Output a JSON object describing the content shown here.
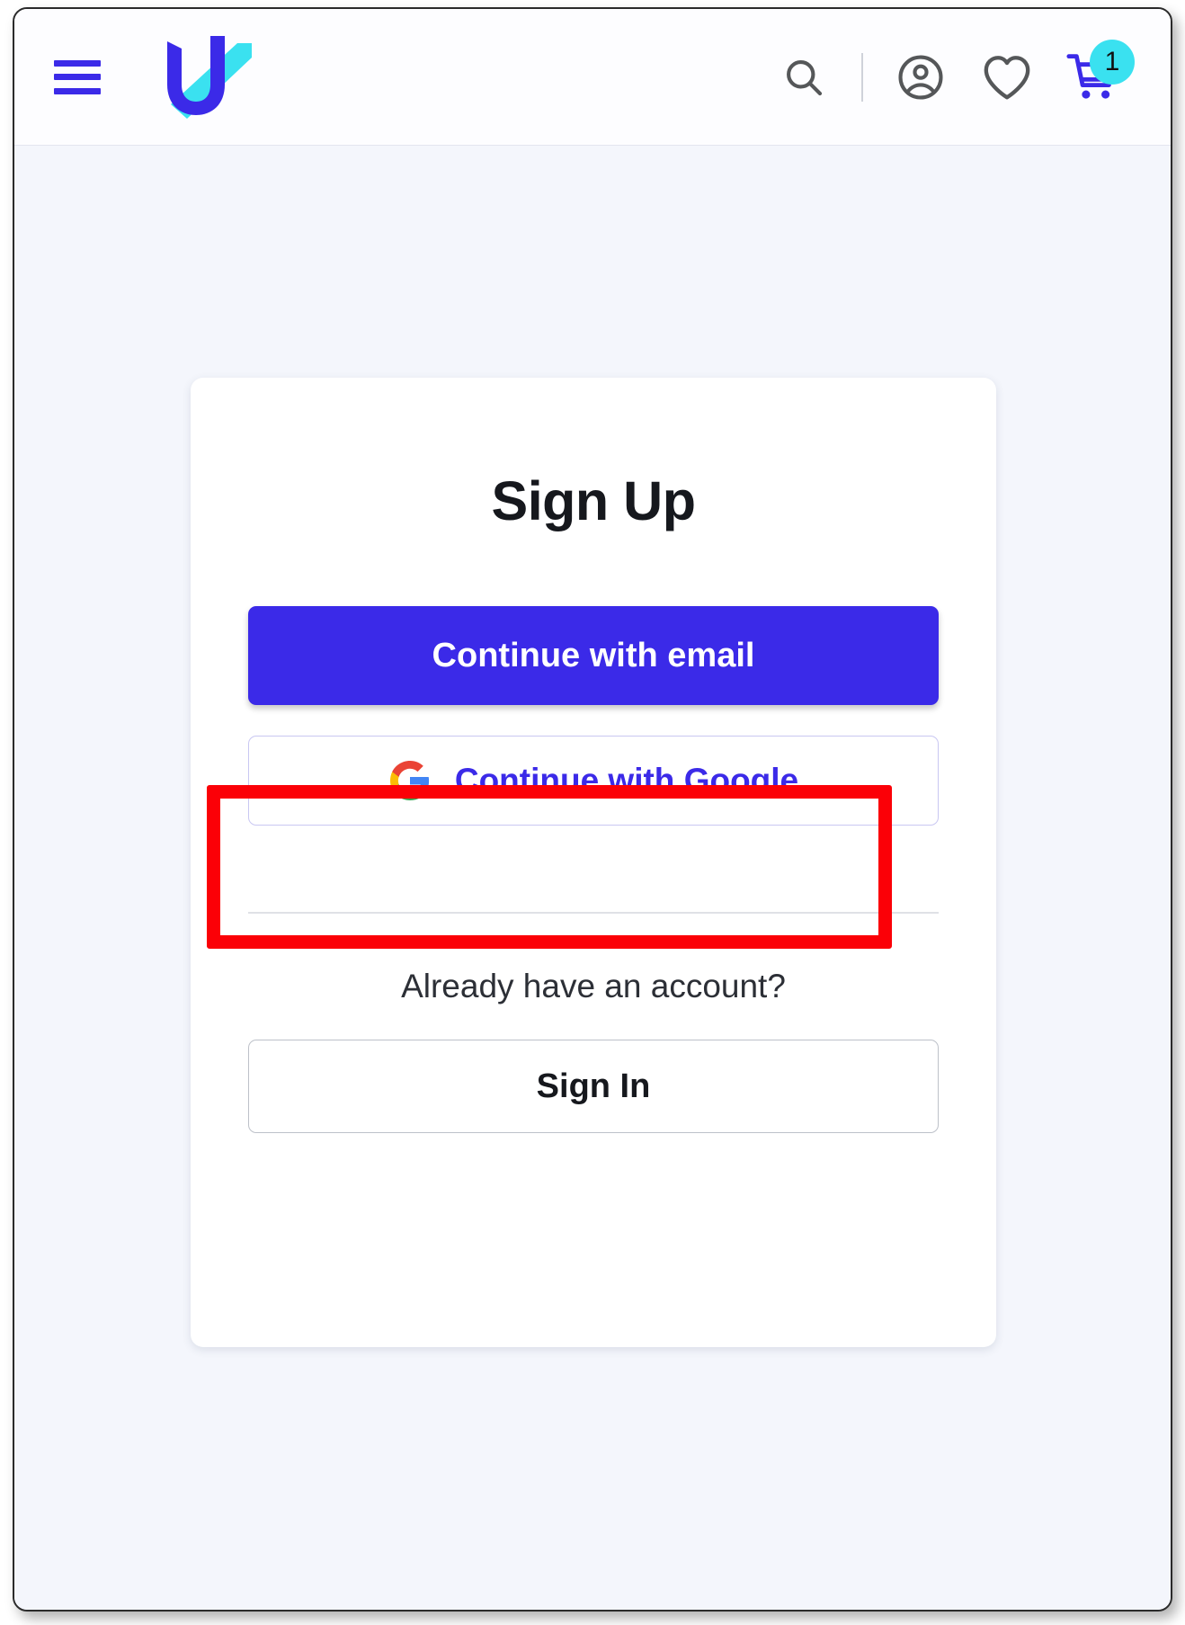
{
  "header": {
    "menu_icon": "hamburger-menu-icon",
    "logo_alt": "U",
    "brand_color": "#3b2ae8",
    "brand_accent_color": "#3ae1f0",
    "actions": [
      {
        "name": "search",
        "icon": "search-icon"
      },
      {
        "name": "account",
        "icon": "user-circle-icon"
      },
      {
        "name": "wishlist",
        "icon": "heart-icon"
      },
      {
        "name": "cart",
        "icon": "shopping-cart-icon"
      }
    ],
    "cart_badge_count": "1"
  },
  "card": {
    "title": "Sign Up",
    "email_button_label": "Continue with email",
    "google_button_label": "Continue with Google",
    "google_icon": "google-g-icon",
    "already_have_account": "Already have an account?",
    "sign_in_button_label": "Sign In"
  },
  "annotation": {
    "type": "highlight-rectangle",
    "color": "#fb0007",
    "target": "Continue with email"
  },
  "colors": {
    "primary": "#3b2ae8",
    "accent_cyan": "#3ae1f0",
    "page_background": "#f4f6fc",
    "card_background": "#ffffff",
    "annotation_red": "#fb0007"
  }
}
